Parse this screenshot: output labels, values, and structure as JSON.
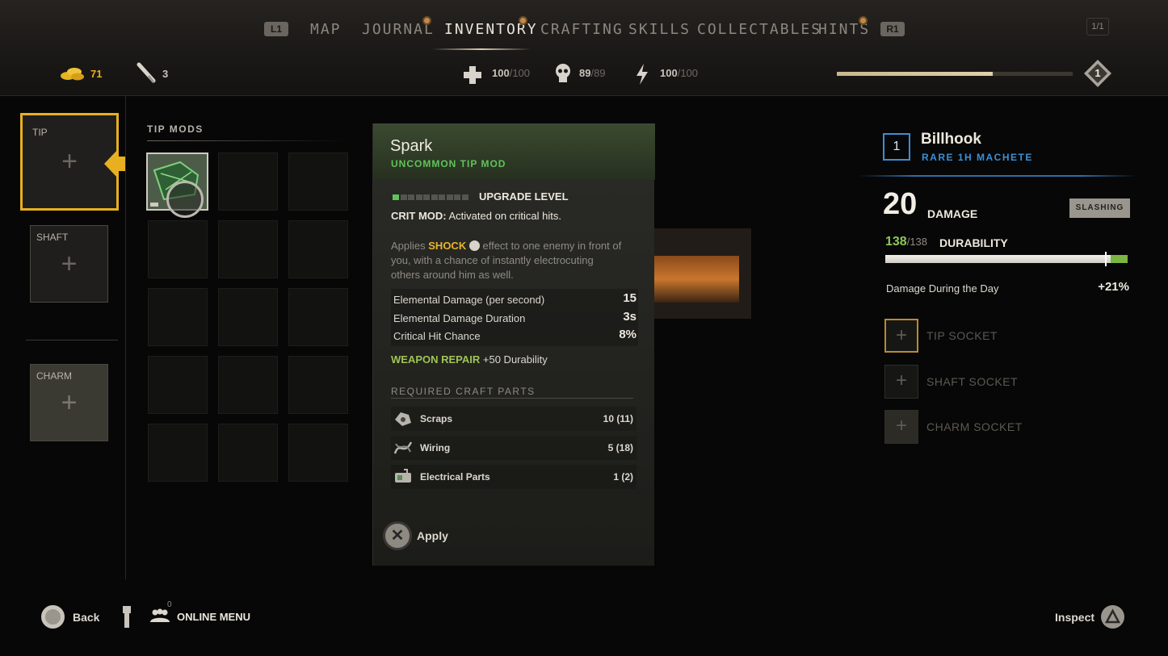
{
  "nav": {
    "l1": "L1",
    "r1": "R1",
    "tabs": [
      {
        "label": "MAP"
      },
      {
        "label": "JOURNAL"
      },
      {
        "label": "INVENTORY"
      },
      {
        "label": "CRAFTING"
      },
      {
        "label": "SKILLS"
      },
      {
        "label": "COLLECTABLES"
      },
      {
        "label": "HINTS"
      }
    ],
    "page_indicator": "1/1"
  },
  "stats": {
    "money": "71",
    "lockpicks": "3",
    "health": "100",
    "health_max": "/100",
    "immunity": "89",
    "immunity_max": "/89",
    "stamina": "100",
    "stamina_max": "/100",
    "level": "1",
    "xp_progress": 0.66
  },
  "slots": {
    "tip": "TIP",
    "shaft": "SHAFT",
    "charm": "CHARM"
  },
  "tip_mods_title": "TIP MODS",
  "tooltip": {
    "name": "Spark",
    "rarity": "UNCOMMON TIP MOD",
    "upgrade_label": "UPGRADE LEVEL",
    "upgrade_level": 1,
    "upgrade_max": 10,
    "crit_label": "CRIT MOD:",
    "crit_text": "Activated on critical hits.",
    "desc_pre": "Applies",
    "desc_keyword": "SHOCK",
    "desc_line1": "effect to one enemy in front of",
    "desc_line2": "you, with a chance of instantly electrocuting",
    "desc_line3": "others around him as well.",
    "attributes": [
      {
        "label": "Elemental Damage (per second)",
        "value": "15"
      },
      {
        "label": "Elemental Damage Duration",
        "value": "3s"
      },
      {
        "label": "Critical Hit Chance",
        "value": "8%"
      }
    ],
    "repair_label": "WEAPON REPAIR",
    "repair_text": "+50 Durability",
    "craft_title": "REQUIRED CRAFT PARTS",
    "parts": [
      {
        "name": "Scraps",
        "count": "10 (11)"
      },
      {
        "name": "Wiring",
        "count": "5 (18)"
      },
      {
        "name": "Electrical Parts",
        "count": "1 (2)"
      }
    ],
    "apply_label": "Apply"
  },
  "weapon": {
    "tier": "1",
    "name": "Billhook",
    "type": "RARE 1H MACHETE",
    "damage": "20",
    "damage_label": "DAMAGE",
    "damage_type": "SLASHING",
    "durability_current": "138",
    "durability_max": "/138",
    "durability_label": "DURABILITY",
    "durability_fraction": 0.93,
    "bonus_label": "Damage During the Day",
    "bonus_value": "+21%",
    "sockets": [
      {
        "label": "TIP SOCKET"
      },
      {
        "label": "SHAFT SOCKET"
      },
      {
        "label": "CHARM SOCKET"
      }
    ]
  },
  "footer": {
    "back": "Back",
    "online_count": "0",
    "online_menu": "ONLINE MENU",
    "inspect": "Inspect"
  },
  "colors": {
    "accent_gold": "#e8b020",
    "uncommon_green": "#5fc35a",
    "rare_blue": "#3a8fd8",
    "shock_yellow": "#e8b530",
    "repair_green": "#9dc456"
  }
}
